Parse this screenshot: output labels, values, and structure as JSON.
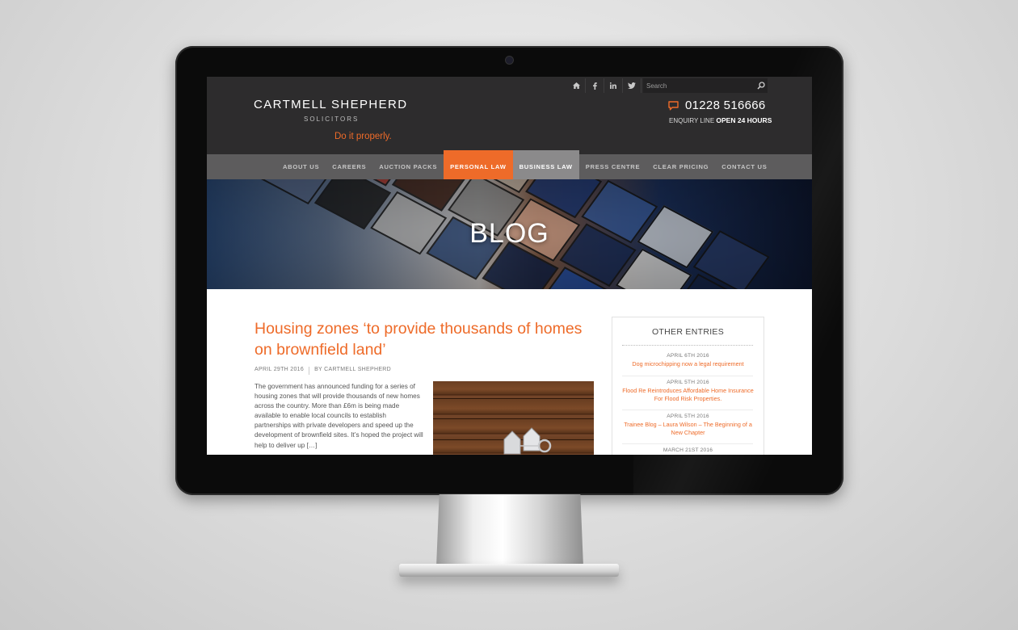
{
  "site": {
    "logo_name": "CARTMELL SHEPHERD",
    "logo_sub": "SOLICITORS",
    "tagline": "Do it properly.",
    "accent_color": "#ee6b29"
  },
  "utility": {
    "icons": [
      "home-icon",
      "facebook-icon",
      "linkedin-icon",
      "twitter-icon"
    ],
    "search_placeholder": "Search"
  },
  "contact": {
    "phone": "01228 516666",
    "enquiry_label": "ENQUIRY LINE",
    "enquiry_hours": "OPEN 24 HOURS"
  },
  "nav": {
    "items": [
      {
        "label": "ABOUT US"
      },
      {
        "label": "CAREERS"
      },
      {
        "label": "AUCTION PACKS"
      },
      {
        "label": "PERSONAL LAW"
      },
      {
        "label": "BUSINESS LAW"
      },
      {
        "label": "PRESS CENTRE"
      },
      {
        "label": "CLEAR PRICING"
      },
      {
        "label": "CONTACT US"
      }
    ]
  },
  "hero": {
    "title": "BLOG"
  },
  "post": {
    "title": "Housing zones ‘to provide thousands of homes on brownfield land’",
    "date": "APRIL 29TH 2016",
    "author": "BY CARTMELL SHEPHERD",
    "excerpt": "The government has announced funding for a series of housing zones that will provide thousands of new homes across the country. More than £6m is being made available to enable local councils to establish partnerships with private developers and speed up the development of brownfield sites. It’s hoped the project will help to deliver up […]"
  },
  "sidebar": {
    "title": "OTHER ENTRIES",
    "entries": [
      {
        "date": "APRIL 6TH 2016",
        "title": "Dog microchipping now a legal requirement"
      },
      {
        "date": "APRIL 5TH 2016",
        "title": "Flood Re Reintroduces Affordable Home Insurance For Flood Risk Properties."
      },
      {
        "date": "APRIL 5TH 2016",
        "title": "Trainee Blog – Laura Wilson – The Beginning of a New Chapter"
      },
      {
        "date": "MARCH 21ST 2016",
        "title": ""
      }
    ]
  }
}
